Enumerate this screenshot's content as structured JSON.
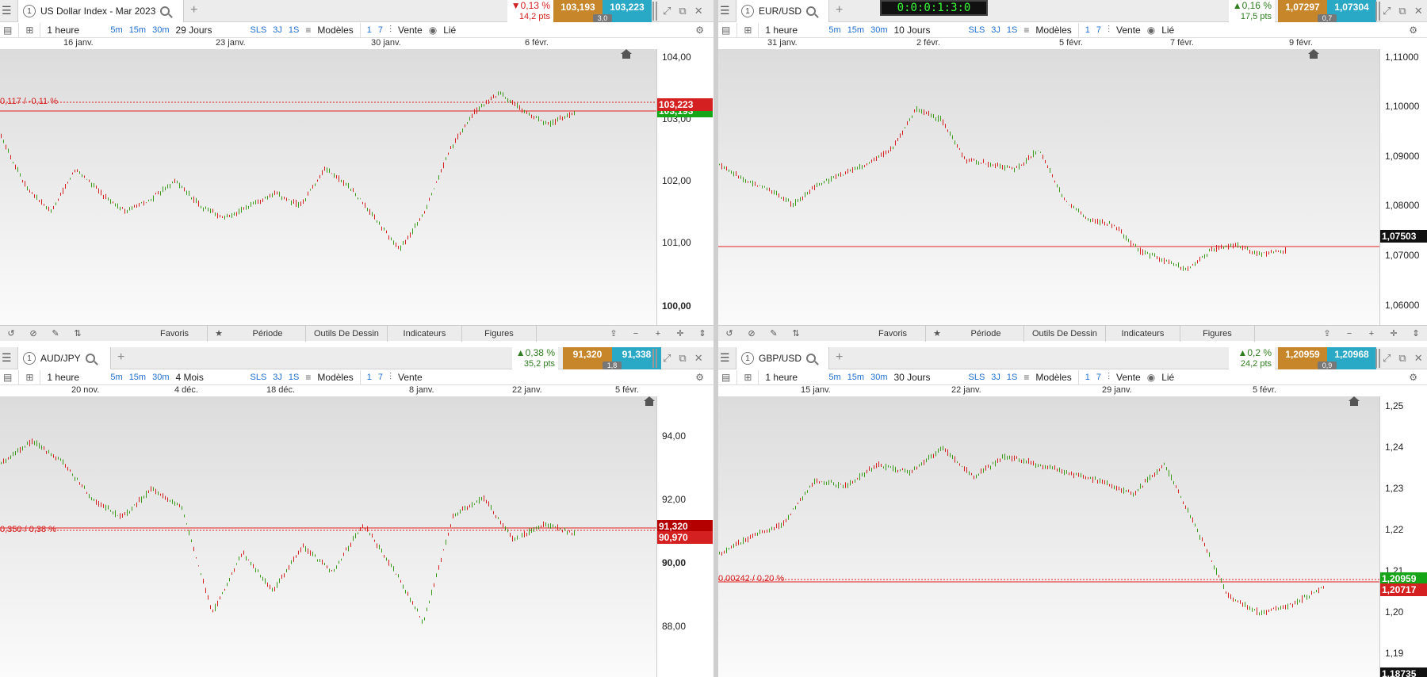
{
  "panels": [
    {
      "tab_number": "1",
      "title": "US Dollar Index - Mar 2023",
      "change_pct": "▼0,13 %",
      "change_pts": "14,2 pts",
      "direction": "dn",
      "bid": "103,193",
      "ask": "103,223",
      "spread": "3,0",
      "period": "1 heure",
      "range": "29 Jours",
      "btn_5m": "5m",
      "btn_15m": "15m",
      "btn_30m": "30m",
      "btn_sls": "SLS",
      "btn_3j": "3J",
      "btn_1s": "1S",
      "modeles": "Modèles",
      "n1": "1",
      "n7": "7",
      "vente": "Vente",
      "lie": "Lié",
      "dates": [
        "16 janv.",
        "23 janv.",
        "30 janv.",
        "6 févr."
      ],
      "y_labels": [
        "104,00",
        "103,00",
        "102,00",
        "101,00",
        "100,00"
      ],
      "price_tag": "103,193",
      "price_tag2": "103,223",
      "ref_label": "0,117 / -0,11 %"
    },
    {
      "tab_number": "1",
      "title": "EUR/USD",
      "change_pct": "▲0,16 %",
      "change_pts": "17,5 pts",
      "direction": "up",
      "bid": "1,07297",
      "ask": "1,07304",
      "spread": "0,7",
      "period": "1 heure",
      "range": "10 Jours",
      "btn_5m": "5m",
      "btn_15m": "15m",
      "btn_30m": "30m",
      "btn_sls": "SLS",
      "btn_3j": "3J",
      "btn_1s": "1S",
      "modeles": "Modèles",
      "n1": "1",
      "n7": "7",
      "vente": "Vente",
      "lie": "Lié",
      "dates": [
        "31 janv.",
        "2 févr.",
        "5 févr.",
        "7 févr.",
        "9 févr."
      ],
      "y_labels": [
        "1,11000",
        "1,10000",
        "1,09000",
        "1,08000",
        "1,07000",
        "1,06000"
      ],
      "price_tag": "1,07503"
    },
    {
      "tab_number": "1",
      "title": "AUD/JPY",
      "change_pct": "▲0,38 %",
      "change_pts": "35,2 pts",
      "direction": "up",
      "bid": "91,320",
      "ask": "91,338",
      "spread": "1,8",
      "period": "1 heure",
      "range": "4 Mois",
      "btn_5m": "5m",
      "btn_15m": "15m",
      "btn_30m": "30m",
      "btn_sls": "SLS",
      "btn_3j": "3J",
      "btn_1s": "1S",
      "modeles": "Modèles",
      "n1": "1",
      "n7": "7",
      "vente": "Vente",
      "dates": [
        "20 nov.",
        "4 déc.",
        "18 déc.",
        "8 janv.",
        "22 janv.",
        "5 févr."
      ],
      "y_labels": [
        "94,00",
        "92,00",
        "90,00",
        "88,00"
      ],
      "price_tag": "91,320",
      "price_tag2": "90,970",
      "ref_label": "0,350 / 0,38 %"
    },
    {
      "tab_number": "1",
      "title": "GBP/USD",
      "change_pct": "▲0,2 %",
      "change_pts": "24,2 pts",
      "direction": "up",
      "bid": "1,20959",
      "ask": "1,20968",
      "spread": "0,9",
      "period": "1 heure",
      "range": "30 Jours",
      "btn_5m": "5m",
      "btn_15m": "15m",
      "btn_30m": "30m",
      "btn_sls": "SLS",
      "btn_3j": "3J",
      "btn_1s": "1S",
      "modeles": "Modèles",
      "n1": "1",
      "n7": "7",
      "vente": "Vente",
      "lie": "Lié",
      "dates": [
        "15 janv.",
        "22 janv.",
        "29 janv.",
        "5 févr."
      ],
      "y_labels": [
        "1,25",
        "1,24",
        "1,23",
        "1,22",
        "1,21",
        "1,20",
        "1,19"
      ],
      "price_tag": "1,20959",
      "price_tag2": "1,20717",
      "price_tag3": "1,18735",
      "ref_label": "0,00242 / 0,20 %"
    }
  ],
  "bottom_bar": {
    "favoris": "Favoris",
    "periode": "Période",
    "outils": "Outils De Dessin",
    "indicateurs": "Indicateurs",
    "figures": "Figures"
  },
  "clock": "0:0:0:1:3:0",
  "chart_data": [
    {
      "type": "line",
      "series": [
        {
          "values": [
            102.8,
            102.0,
            101.6,
            102.3,
            101.9,
            101.6,
            101.8,
            102.1,
            101.7,
            101.5,
            101.7,
            101.9,
            101.7,
            102.3,
            102.0,
            101.5,
            101.0,
            101.6,
            102.6,
            103.2,
            103.5,
            103.2,
            103.0,
            103.2
          ]
        }
      ],
      "ylim": [
        99.8,
        104.2
      ]
    },
    {
      "type": "line",
      "series": [
        {
          "values": [
            1.09,
            1.087,
            1.085,
            1.082,
            1.086,
            1.088,
            1.09,
            1.093,
            1.101,
            1.099,
            1.091,
            1.09,
            1.089,
            1.093,
            1.083,
            1.079,
            1.078,
            1.073,
            1.071,
            1.069,
            1.073,
            1.074,
            1.072,
            1.073
          ]
        }
      ],
      "ylim": [
        1.058,
        1.113
      ]
    },
    {
      "type": "line",
      "series": [
        {
          "values": [
            93.5,
            94.2,
            93.6,
            92.4,
            91.8,
            92.7,
            92.1,
            88.8,
            90.7,
            89.5,
            90.9,
            90.1,
            91.6,
            90.2,
            88.5,
            91.9,
            92.4,
            91.1,
            91.6,
            91.3
          ]
        }
      ],
      "ylim": [
        86.8,
        95.6
      ]
    },
    {
      "type": "line",
      "series": [
        {
          "values": [
            1.217,
            1.221,
            1.224,
            1.234,
            1.233,
            1.238,
            1.236,
            1.242,
            1.235,
            1.24,
            1.238,
            1.236,
            1.234,
            1.231,
            1.238,
            1.223,
            1.207,
            1.203,
            1.205,
            1.209
          ]
        }
      ],
      "ylim": [
        1.188,
        1.254
      ]
    }
  ]
}
